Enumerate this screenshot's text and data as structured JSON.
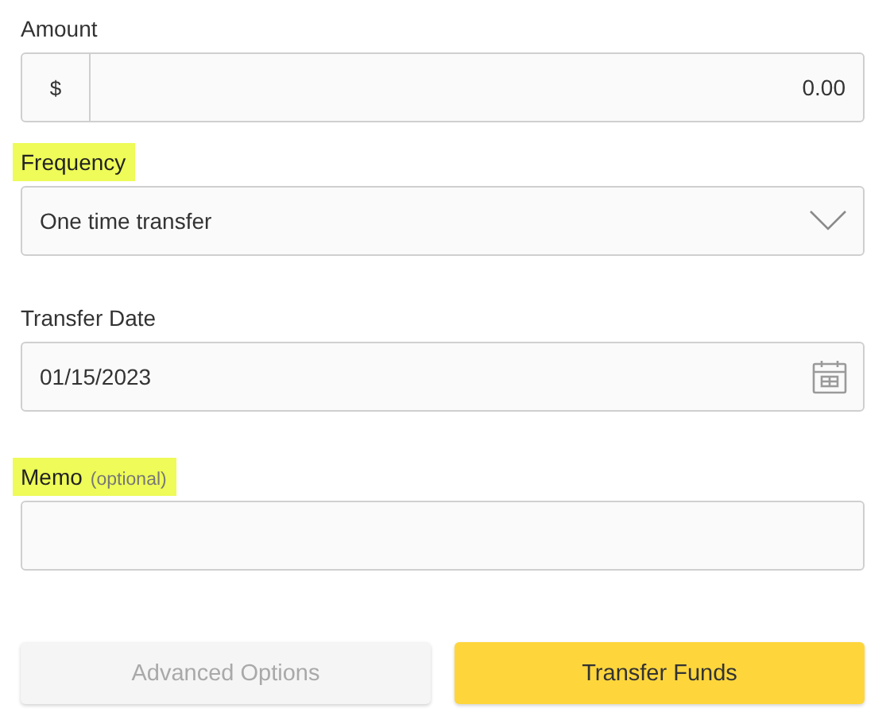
{
  "fields": [
    {
      "kind": "amount",
      "label": "Amount",
      "highlighted": false,
      "prefix": "$",
      "value": "0.00"
    },
    {
      "kind": "select",
      "label": "Frequency",
      "highlighted": true,
      "value": "One time transfer"
    },
    {
      "kind": "date",
      "label": "Transfer Date",
      "highlighted": false,
      "value": "01/15/2023"
    },
    {
      "kind": "text",
      "label": "Memo",
      "hint": "(optional)",
      "highlighted": true
    }
  ],
  "buttons": [
    {
      "label": "Advanced Options",
      "kind": "secondary",
      "disabled": true
    },
    {
      "label": "Transfer Funds",
      "kind": "primary",
      "disabled": false
    }
  ]
}
